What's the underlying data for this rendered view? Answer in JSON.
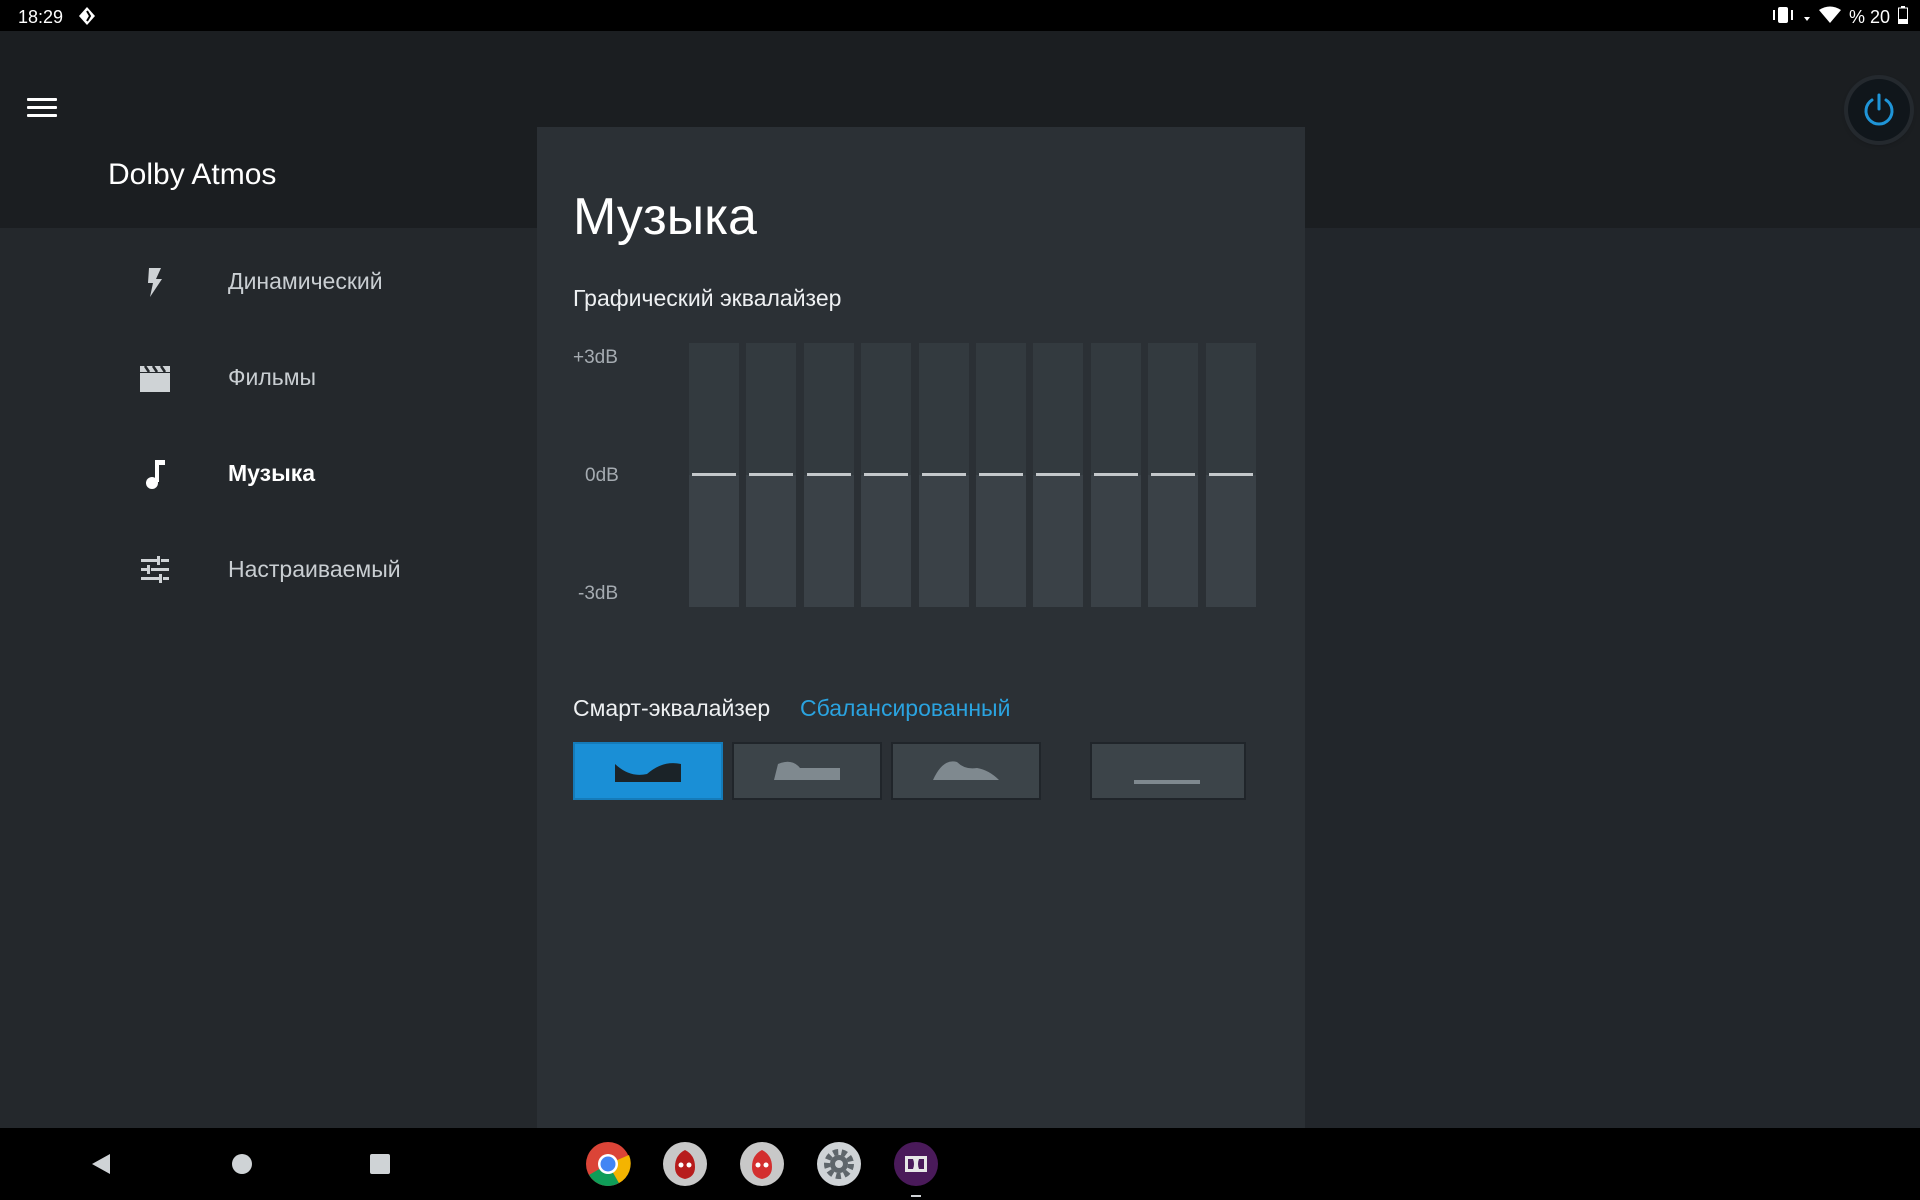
{
  "status_bar": {
    "time": "18:29",
    "battery_label": "% 20"
  },
  "app": {
    "title": "Dolby Atmos"
  },
  "sidebar": {
    "items": [
      {
        "label": "Динамический",
        "icon": "bolt-icon",
        "active": false
      },
      {
        "label": "Фильмы",
        "icon": "clapperboard-icon",
        "active": false
      },
      {
        "label": "Музыка",
        "icon": "music-note-icon",
        "active": true
      },
      {
        "label": "Настраиваемый",
        "icon": "tune-sliders-icon",
        "active": false
      }
    ]
  },
  "panel": {
    "title": "Музыка",
    "graphic_eq": {
      "label": "Графический эквалайзер",
      "db_labels": {
        "top": "+3dB",
        "mid": "0dB",
        "bottom": "-3dB"
      },
      "bands_db": [
        0,
        0,
        0,
        0,
        0,
        0,
        0,
        0,
        0,
        0
      ]
    },
    "smart_eq": {
      "label": "Смарт-эквалайзер",
      "value": "Сбалансированный",
      "presets": [
        {
          "name": "balanced-preset",
          "active": true
        },
        {
          "name": "warm-preset",
          "active": false
        },
        {
          "name": "detailed-preset",
          "active": false
        },
        {
          "name": "flat-preset",
          "active": false
        }
      ]
    }
  },
  "colors": {
    "accent": "#1a8fd6",
    "accent_text": "#2aa3e0",
    "background": "#22262b",
    "panel": "#2b3035"
  },
  "dock": [
    "chrome-icon",
    "antutu-3d-icon",
    "antutu-icon",
    "settings-icon",
    "dolby-icon"
  ]
}
